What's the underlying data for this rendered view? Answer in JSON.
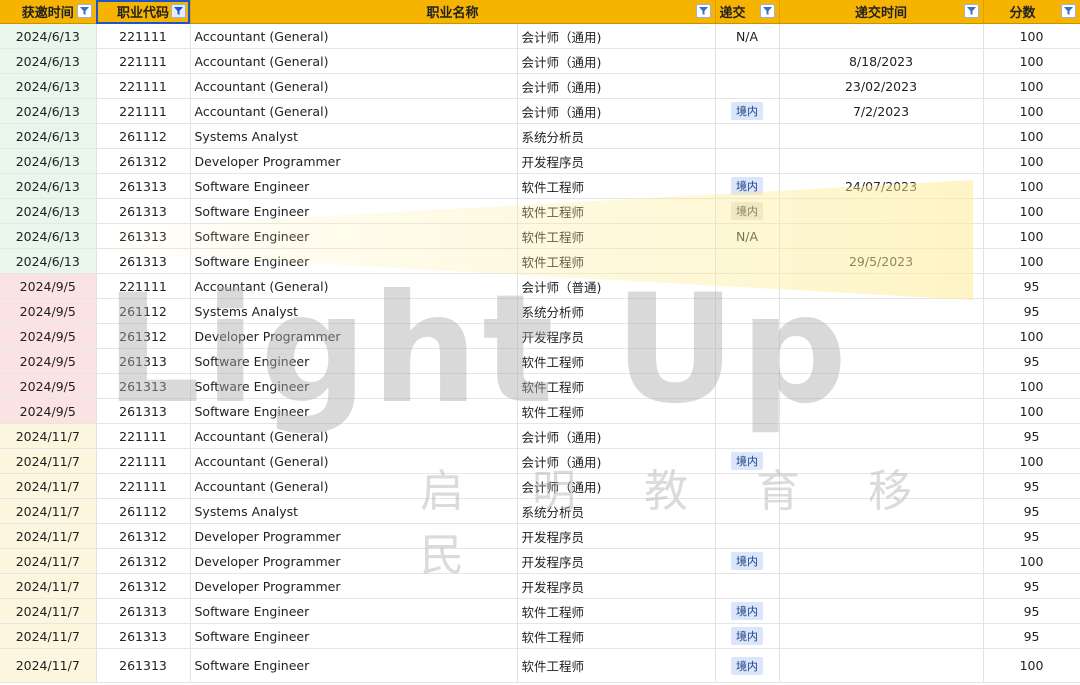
{
  "headers": [
    {
      "label": "获邀时间",
      "filter_icon": "filter-icon"
    },
    {
      "label": "职业代码",
      "filter_icon": "filter-active-icon"
    },
    {
      "label": "职业名称",
      "filter_icon": "filter-icon"
    },
    {
      "label": "递交",
      "filter_icon": "filter-icon"
    },
    {
      "label": "递交时间",
      "filter_icon": "filter-icon"
    },
    {
      "label": "分数",
      "filter_icon": "filter-icon"
    }
  ],
  "rows": [
    {
      "date": "2024/6/13",
      "code": "221111",
      "en": "Accountant (General)",
      "cn": "会计师（通用)",
      "sub": "N/A",
      "sub_time": "",
      "score": "100"
    },
    {
      "date": "2024/6/13",
      "code": "221111",
      "en": "Accountant (General)",
      "cn": "会计师（通用)",
      "sub": "",
      "sub_time": "8/18/2023",
      "score": "100"
    },
    {
      "date": "2024/6/13",
      "code": "221111",
      "en": "Accountant (General)",
      "cn": "会计师（通用)",
      "sub": "",
      "sub_time": "23/02/2023",
      "score": "100"
    },
    {
      "date": "2024/6/13",
      "code": "221111",
      "en": "Accountant (General)",
      "cn": "会计师（通用)",
      "sub": "境内",
      "sub_time": "7/2/2023",
      "score": "100"
    },
    {
      "date": "2024/6/13",
      "code": "261112",
      "en": "Systems Analyst",
      "cn": "系统分析员",
      "sub": "",
      "sub_time": "",
      "score": "100"
    },
    {
      "date": "2024/6/13",
      "code": "261312",
      "en": "Developer Programmer",
      "cn": "开发程序员",
      "sub": "",
      "sub_time": "",
      "score": "100"
    },
    {
      "date": "2024/6/13",
      "code": "261313",
      "en": "Software Engineer",
      "cn": "软件工程师",
      "sub": "境内",
      "sub_time": "24/07/2023",
      "score": "100"
    },
    {
      "date": "2024/6/13",
      "code": "261313",
      "en": "Software Engineer",
      "cn": "软件工程师",
      "sub": "境内",
      "sub_time": "",
      "score": "100"
    },
    {
      "date": "2024/6/13",
      "code": "261313",
      "en": "Software Engineer",
      "cn": "软件工程师",
      "sub": "N/A",
      "sub_time": "",
      "score": "100"
    },
    {
      "date": "2024/6/13",
      "code": "261313",
      "en": "Software Engineer",
      "cn": "软件工程师",
      "sub": "",
      "sub_time": "29/5/2023",
      "score": "100"
    },
    {
      "date": "2024/9/5",
      "code": "221111",
      "en": "Accountant (General)",
      "cn": "会计师（普通)",
      "sub": "",
      "sub_time": "",
      "score": "95"
    },
    {
      "date": "2024/9/5",
      "code": "261112",
      "en": "Systems Analyst",
      "cn": "系统分析师",
      "sub": "",
      "sub_time": "",
      "score": "95"
    },
    {
      "date": "2024/9/5",
      "code": "261312",
      "en": "Developer Programmer",
      "cn": "开发程序员",
      "sub": "",
      "sub_time": "",
      "score": "100"
    },
    {
      "date": "2024/9/5",
      "code": "261313",
      "en": "Software Engineer",
      "cn": "软件工程师",
      "sub": "",
      "sub_time": "",
      "score": "95"
    },
    {
      "date": "2024/9/5",
      "code": "261313",
      "en": "Software Engineer",
      "cn": "软件工程师",
      "sub": "",
      "sub_time": "",
      "score": "100"
    },
    {
      "date": "2024/9/5",
      "code": "261313",
      "en": "Software Engineer",
      "cn": "软件工程师",
      "sub": "",
      "sub_time": "",
      "score": "100"
    },
    {
      "date": "2024/11/7",
      "code": "221111",
      "en": "Accountant (General)",
      "cn": "会计师（通用)",
      "sub": "",
      "sub_time": "",
      "score": "95"
    },
    {
      "date": "2024/11/7",
      "code": "221111",
      "en": "Accountant (General)",
      "cn": "会计师（通用)",
      "sub": "境内",
      "sub_time": "",
      "score": "100"
    },
    {
      "date": "2024/11/7",
      "code": "221111",
      "en": "Accountant (General)",
      "cn": "会计师（通用)",
      "sub": "",
      "sub_time": "",
      "score": "95"
    },
    {
      "date": "2024/11/7",
      "code": "261112",
      "en": "Systems Analyst",
      "cn": "系统分析员",
      "sub": "",
      "sub_time": "",
      "score": "95"
    },
    {
      "date": "2024/11/7",
      "code": "261312",
      "en": "Developer Programmer",
      "cn": "开发程序员",
      "sub": "",
      "sub_time": "",
      "score": "95"
    },
    {
      "date": "2024/11/7",
      "code": "261312",
      "en": "Developer Programmer",
      "cn": "开发程序员",
      "sub": "境内",
      "sub_time": "",
      "score": "100"
    },
    {
      "date": "2024/11/7",
      "code": "261312",
      "en": "Developer Programmer",
      "cn": "开发程序员",
      "sub": "",
      "sub_time": "",
      "score": "95"
    },
    {
      "date": "2024/11/7",
      "code": "261313",
      "en": "Software Engineer",
      "cn": "软件工程师",
      "sub": "境内",
      "sub_time": "",
      "score": "95"
    },
    {
      "date": "2024/11/7",
      "code": "261313",
      "en": "Software Engineer",
      "cn": "软件工程师",
      "sub": "境内",
      "sub_time": "",
      "score": "95"
    },
    {
      "date": "2024/11/7",
      "code": "261313",
      "en": "Software Engineer",
      "cn": "软件工程师",
      "sub": "境内",
      "sub_time": "",
      "score": "100"
    }
  ],
  "watermark": {
    "main": "Light Up",
    "sub": "启明教育移民"
  },
  "colors": {
    "header": "#f6b400",
    "jun": "#e8f6ec",
    "sep": "#fce3e3",
    "nov": "#fdf6df",
    "badge": "#dbe6fb"
  }
}
